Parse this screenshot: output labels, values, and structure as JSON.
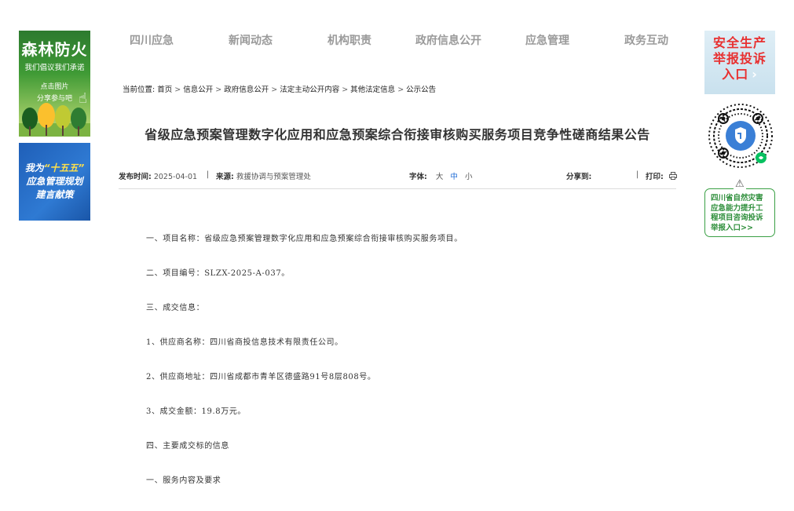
{
  "left_banners": {
    "forest": {
      "title": "森林防火",
      "slogan": "我们倡议我们承诺",
      "cta_line1": "点击图片",
      "cta_line2": "分享参与吧"
    },
    "plan": {
      "line1_prefix": "我为",
      "line1_highlight": "“十五五”",
      "line2": "应急管理规划",
      "line3": "建言献策"
    }
  },
  "nav": {
    "items": [
      {
        "label": "四川应急"
      },
      {
        "label": "新闻动态"
      },
      {
        "label": "机构职责"
      },
      {
        "label": "政府信息公开"
      },
      {
        "label": "应急管理"
      },
      {
        "label": "政务互动"
      }
    ]
  },
  "breadcrumb": {
    "prefix": "当前位置:",
    "items": [
      {
        "label": "首页"
      },
      {
        "label": "信息公开"
      },
      {
        "label": "政府信息公开"
      },
      {
        "label": "法定主动公开内容"
      },
      {
        "label": "其他法定信息"
      },
      {
        "label": "公示公告"
      }
    ],
    "separator": ">"
  },
  "article": {
    "title": "省级应急预案管理数字化应用和应急预案综合衔接审核购买服务项目竞争性磋商结果公告",
    "meta": {
      "date_label": "发布时间:",
      "date": "2025-04-01",
      "divider": "|",
      "source_label": "来源:",
      "source": "救援协调与预案管理处",
      "font_label": "字体:",
      "font_large": "大",
      "font_medium": "中",
      "font_small": "小",
      "share_label": "分享到:",
      "print_label": "打印:",
      "print_icon": "printer-icon"
    },
    "paragraphs": [
      "一、项目名称：省级应急预案管理数字化应用和应急预案综合衔接审核购买服务项目。",
      "二、项目编号：SLZX-2025-A-037。",
      "三、成交信息：",
      "1、供应商名称：四川省商投信息技术有限责任公司。",
      "2、供应商地址：四川省成都市青羊区德盛路91号8层808号。",
      "3、成交金额：19.8万元。",
      "四、主要成交标的信息",
      "一、服务内容及要求"
    ]
  },
  "right_column": {
    "report_box": {
      "line1": "安全生产",
      "line2": "举报投诉",
      "line3": "入口",
      "arrow": "›"
    },
    "disaster_box": {
      "warn_icon": "⚠",
      "lines": [
        "四川省自然灾害",
        "应急能力提升工",
        "程项目咨询投诉",
        "举报入口>>"
      ]
    }
  },
  "colors": {
    "nav_text": "#9a9a9a",
    "accent_blue": "#1e6bd6",
    "report_red": "#e83030",
    "disaster_green": "#2f8f3c"
  }
}
